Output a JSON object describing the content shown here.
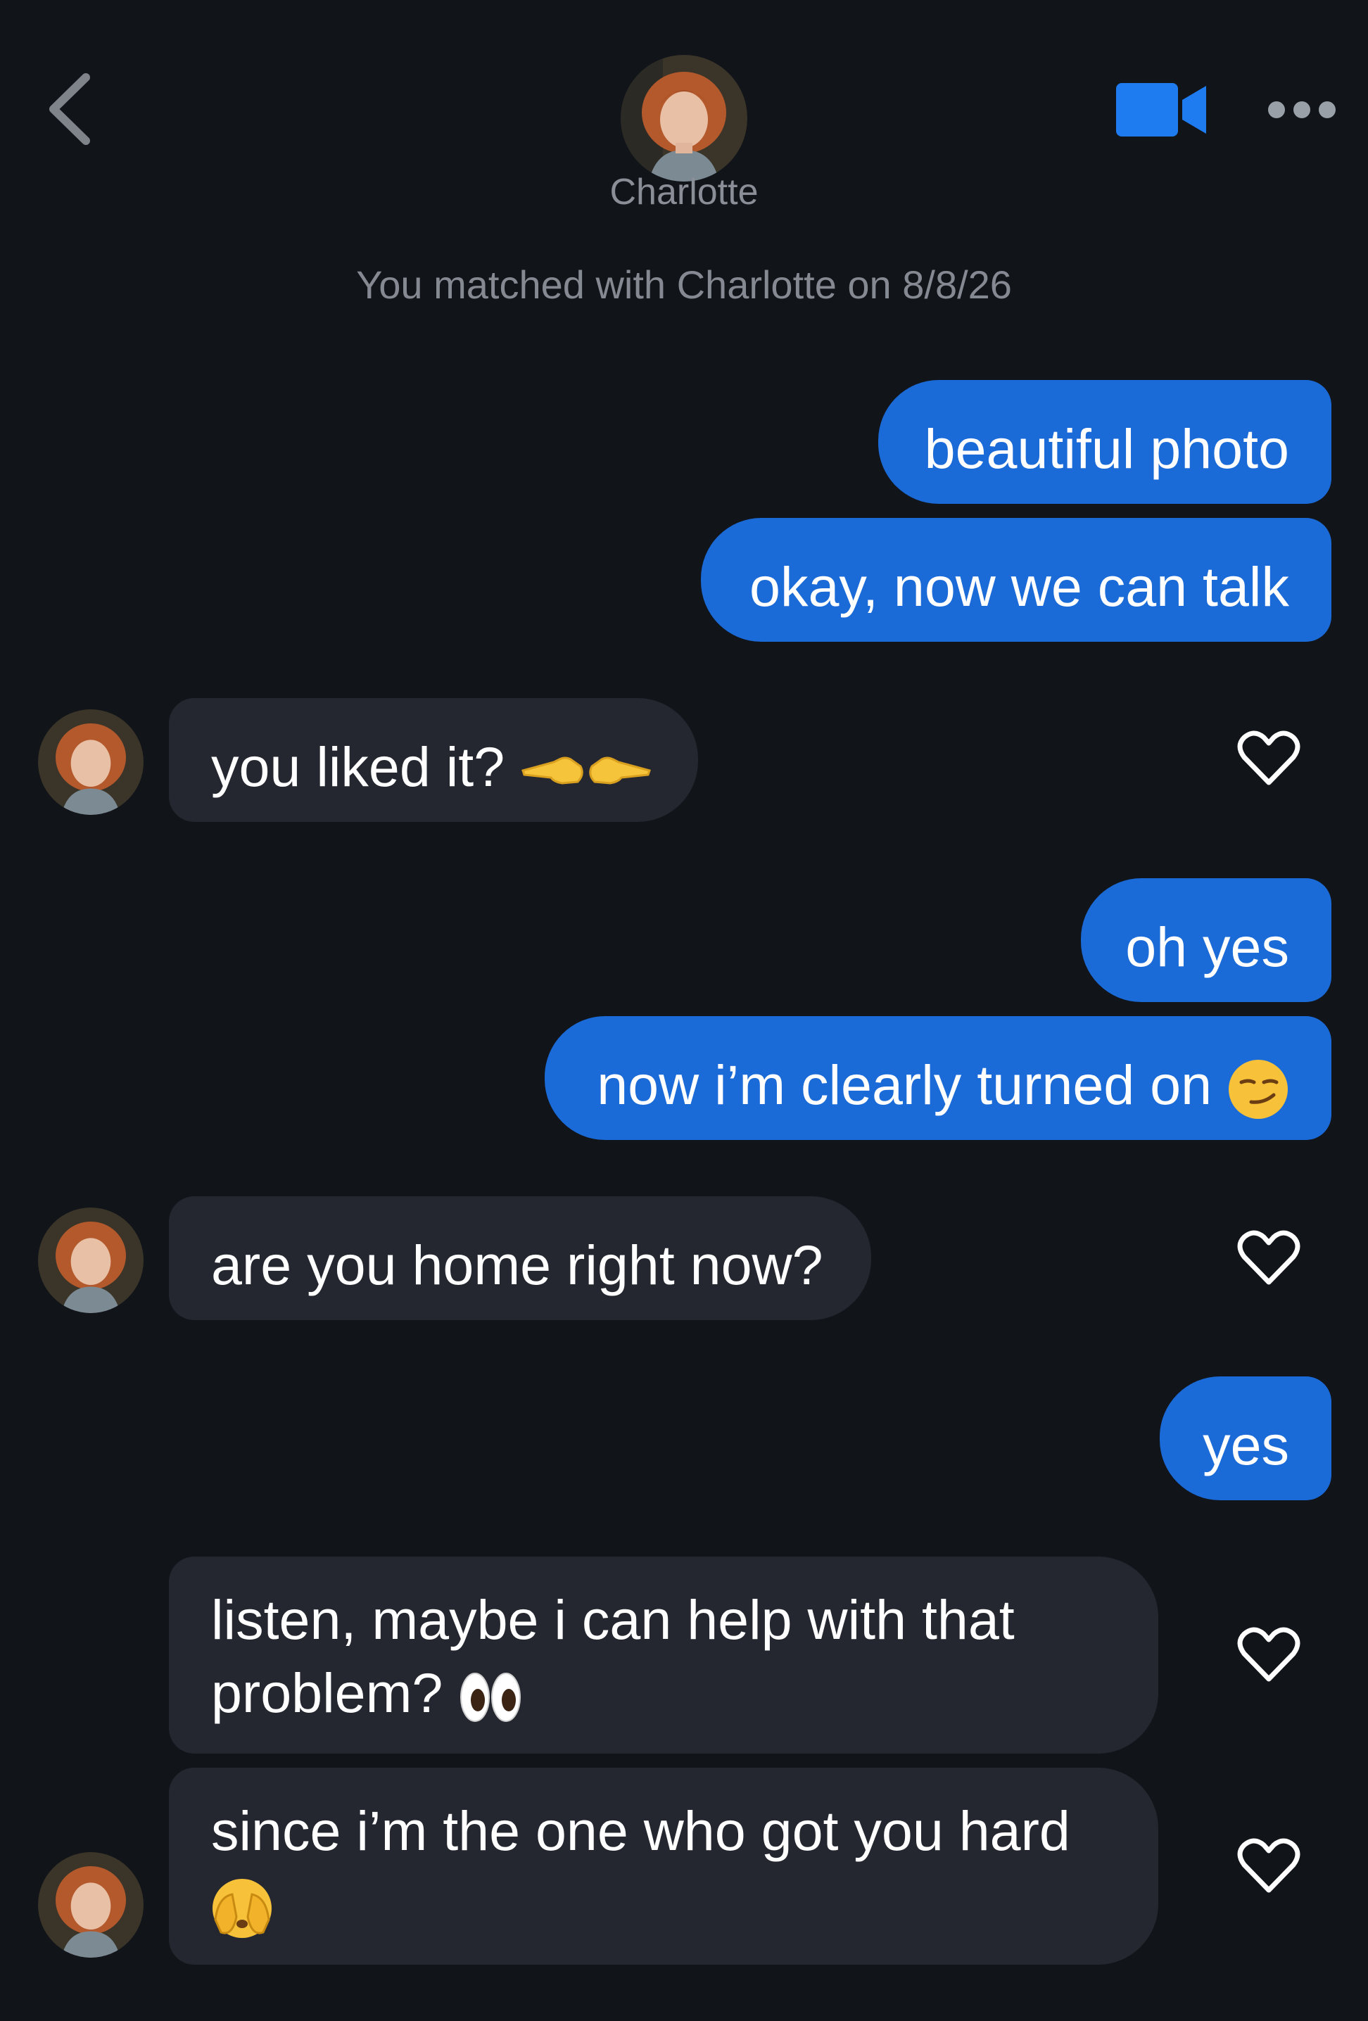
{
  "header": {
    "back_icon": "chevron-left-icon",
    "contact_name": "Charlotte",
    "video_icon": "video-camera-icon",
    "more_icon": "more-dots-icon"
  },
  "match_note": "You matched with Charlotte on 8/8/26",
  "colors": {
    "background": "#111419",
    "sent_bubble": "#1a6ad8",
    "received_bubble": "#24272f",
    "accent": "#1e7bf0"
  },
  "messages": [
    {
      "from": "me",
      "text": "beautiful photo"
    },
    {
      "from": "me",
      "text": "okay, now we can talk"
    },
    {
      "from": "Charlotte",
      "text": "you liked it?",
      "emoji": "pointing-hands-emoji"
    },
    {
      "from": "me",
      "text": "oh yes"
    },
    {
      "from": "me",
      "text": "now i’m clearly turned on",
      "emoji": "smirking-face-emoji"
    },
    {
      "from": "Charlotte",
      "text": "are you home right now?"
    },
    {
      "from": "me",
      "text": "yes"
    },
    {
      "from": "Charlotte",
      "text": "listen, maybe i can help with that problem?",
      "emoji": "eyes-emoji"
    },
    {
      "from": "Charlotte",
      "text": "since i’m the one who got you hard",
      "emoji": "face-with-hands-over-mouth-emoji"
    }
  ]
}
